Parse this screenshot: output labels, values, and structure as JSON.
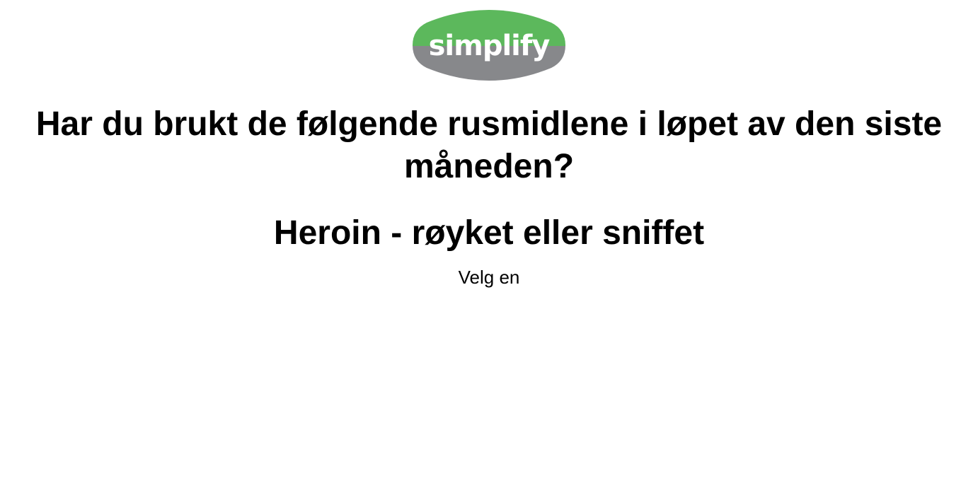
{
  "logo": {
    "text": "simplify",
    "colors": {
      "top": "#5cb85c",
      "bottom": "#87888b",
      "text": "#ffffff"
    }
  },
  "question": {
    "text": "Har du brukt de følgende rusmidlene i løpet av den siste måneden?"
  },
  "item": {
    "title": "Heroin - røyket eller sniffet"
  },
  "instruction": {
    "text": "Velg en"
  }
}
